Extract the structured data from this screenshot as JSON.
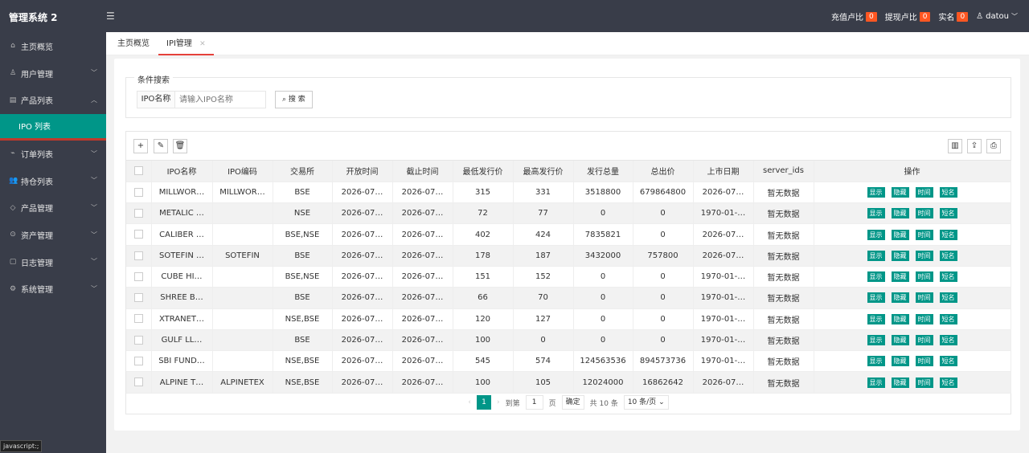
{
  "app": {
    "title": "管理系统 2",
    "menu_toggle_icon": "hamburger-icon"
  },
  "header": {
    "recharge_label": "充值卢比",
    "recharge_count": "0",
    "withdraw_label": "提现卢比",
    "withdraw_count": "0",
    "realname_label": "实名",
    "realname_count": "0",
    "user": "datou"
  },
  "sidebar": {
    "items": [
      {
        "label": "主页概览",
        "icon": "home-icon"
      },
      {
        "label": "用户管理",
        "icon": "user-icon"
      },
      {
        "label": "产品列表",
        "icon": "list-icon"
      },
      {
        "label": "IPO 列表"
      },
      {
        "label": "订单列表",
        "icon": "order-icon"
      },
      {
        "label": "持仓列表",
        "icon": "users-icon"
      },
      {
        "label": "产品管理",
        "icon": "diamond-icon"
      },
      {
        "label": "资产管理",
        "icon": "money-icon"
      },
      {
        "label": "日志管理",
        "icon": "log-icon"
      },
      {
        "label": "系统管理",
        "icon": "gear-icon"
      }
    ]
  },
  "status_tip": "javascript:;",
  "tabs": [
    {
      "label": "主页概览"
    },
    {
      "label": "IPI管理"
    }
  ],
  "search": {
    "legend": "条件搜索",
    "field_label": "IPO名称",
    "placeholder": "请输入IPO名称",
    "button": "搜 索"
  },
  "table": {
    "headers": [
      "IPO名称",
      "IPO编码",
      "交易所",
      "开放时间",
      "截止时间",
      "最低发行价",
      "最高发行价",
      "发行总量",
      "总出价",
      "上市日期",
      "server_ids",
      "操作"
    ],
    "actions": [
      "显示",
      "隐藏",
      "时间",
      "短名"
    ],
    "rows": [
      [
        "MILLWOR…",
        "MILLWOR…",
        "BSE",
        "2026-07…",
        "2026-07…",
        "315",
        "331",
        "3518800",
        "679864800",
        "2026-07…",
        "暂无数据"
      ],
      [
        "METALIC …",
        "",
        "NSE",
        "2026-07…",
        "2026-07…",
        "72",
        "77",
        "0",
        "0",
        "1970-01-…",
        "暂无数据"
      ],
      [
        "CALIBER …",
        "",
        "BSE,NSE",
        "2026-07…",
        "2026-07…",
        "402",
        "424",
        "7835821",
        "0",
        "2026-07…",
        "暂无数据"
      ],
      [
        "SOTEFIN …",
        "SOTEFIN",
        "BSE",
        "2026-07…",
        "2026-07…",
        "178",
        "187",
        "3432000",
        "757800",
        "2026-07…",
        "暂无数据"
      ],
      [
        "CUBE HI…",
        "",
        "BSE,NSE",
        "2026-07…",
        "2026-07…",
        "151",
        "152",
        "0",
        "0",
        "1970-01-…",
        "暂无数据"
      ],
      [
        "SHREE B…",
        "",
        "BSE",
        "2026-07…",
        "2026-07…",
        "66",
        "70",
        "0",
        "0",
        "1970-01-…",
        "暂无数据"
      ],
      [
        "XTRANET…",
        "",
        "NSE,BSE",
        "2026-07…",
        "2026-07…",
        "120",
        "127",
        "0",
        "0",
        "1970-01-…",
        "暂无数据"
      ],
      [
        "GULF LL…",
        "",
        "BSE",
        "2026-07…",
        "2026-07…",
        "100",
        "0",
        "0",
        "0",
        "1970-01-…",
        "暂无数据"
      ],
      [
        "SBI FUND…",
        "",
        "NSE,BSE",
        "2026-07…",
        "2026-07…",
        "545",
        "574",
        "124563536",
        "894573736",
        "1970-01-…",
        "暂无数据"
      ],
      [
        "ALPINE T…",
        "ALPINETEX",
        "NSE,BSE",
        "2026-07…",
        "2026-07…",
        "100",
        "105",
        "12024000",
        "16862642",
        "2026-07…",
        "暂无数据"
      ]
    ]
  },
  "pager": {
    "current": "1",
    "goto_label": "到第",
    "page_input": "1",
    "page_unit": "页",
    "confirm": "确定",
    "total": "共 10 条",
    "page_size": "10 条/页"
  },
  "colors": {
    "accent": "#009688",
    "topbar": "#393d49",
    "badge": "#ff5722",
    "tab_underline": "#e5413a"
  }
}
